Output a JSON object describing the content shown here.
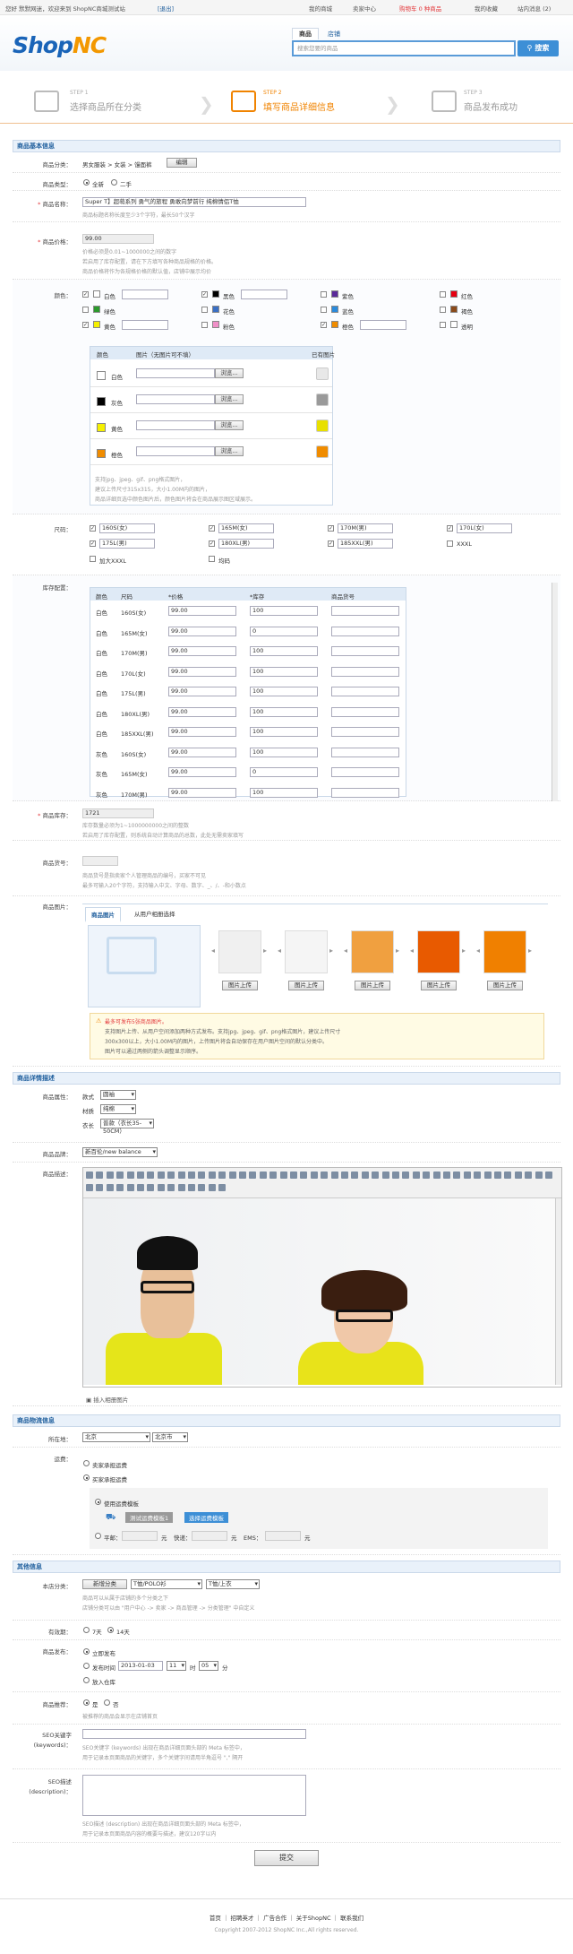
{
  "topbar": {
    "welcome": "您好 默默网迷，欢迎来到 ShopNC商城测试站",
    "logout": "[退出]",
    "my_mall": "我的商城",
    "seller_center": "卖家中心",
    "cart": "购物车 0 种商品",
    "favorites": "我的收藏",
    "messages": "站内消息 (2)"
  },
  "header": {
    "logo_shop": "Shop",
    "logo_nc": "NC",
    "tab_goods": "商品",
    "tab_store": "店铺",
    "search_placeholder": "搜索您要的商品",
    "search_btn": "搜索"
  },
  "steps": [
    {
      "n": "STEP 1",
      "label": "选择商品所在分类"
    },
    {
      "n": "STEP 2",
      "label": "填写商品详细信息"
    },
    {
      "n": "STEP 3",
      "label": "商品发布成功"
    }
  ],
  "basic": {
    "title": "商品基本信息",
    "category_label": "商品分类：",
    "category_value": "男女服装 > 女装 > 馒面裤",
    "edit_btn": "编辑",
    "type_label": "商品类型：",
    "type_new": "全新",
    "type_used": "二手",
    "name_label": "商品名称：",
    "name_value": "Super T】超萌系列 勇气的旅程 勇敢向梦前行 纯棉情侣T恤",
    "name_hint": "商品标题名称长度至少3个字符，最长50个汉字",
    "price_label": "商品价格：",
    "price_value": "99.00",
    "price_hint1": "价格必须是0.01~1000000之间的数字",
    "price_hint2": "若启用了库存配置，请在下方填写各种商品规格的价格。",
    "price_hint3": "商品价格将作为各规格价格的默认值，店铺中展示均价"
  },
  "color": {
    "label": "颜色：",
    "items": [
      {
        "name": "白色",
        "c": "#ffffff",
        "on": true
      },
      {
        "name": "黑色",
        "c": "#000000",
        "on": true
      },
      {
        "name": "紫色",
        "c": "#5a2a9a",
        "on": false
      },
      {
        "name": "红色",
        "c": "#e60012",
        "on": false
      },
      {
        "name": "绿色",
        "c": "#2c9a2c",
        "on": false
      },
      {
        "name": "花色",
        "c": "#3a6fc4",
        "on": false
      },
      {
        "name": "蓝色",
        "c": "#2a8adc",
        "on": false
      },
      {
        "name": "褐色",
        "c": "#8a4a1a",
        "on": false
      },
      {
        "name": "黄色",
        "c": "#f5f000",
        "on": true
      },
      {
        "name": "粉色",
        "c": "#f090c8",
        "on": false
      },
      {
        "name": "橙色",
        "c": "#f08c00",
        "on": true
      },
      {
        "name": "透明",
        "c": "#ffffff",
        "on": false
      }
    ],
    "table_head": {
      "color": "颜色",
      "image": "图片（无图片可不填）",
      "existing": "已有图片"
    },
    "rows": [
      {
        "name": "白色",
        "c": "#ffffff",
        "tc": "#e8e8e8"
      },
      {
        "name": "灰色",
        "c": "#000000",
        "tc": "#9a9a9a"
      },
      {
        "name": "黄色",
        "c": "#f5f000",
        "tc": "#e8e000"
      },
      {
        "name": "橙色",
        "c": "#f08c00",
        "tc": "#f08c00"
      }
    ],
    "browse": "浏览...",
    "hint1": "支持jpg、jpeg、gif、png格式图片，",
    "hint2": "建议上传尺寸315x315，大小1.00M内的图片，",
    "hint3": "商品详细页选中颜色图片后，颜色图片将会在商品展示图区域展示。"
  },
  "size": {
    "label": "尺码：",
    "items": [
      {
        "n": "160S(女)",
        "on": true,
        "i": true
      },
      {
        "n": "165M(女)",
        "on": true,
        "i": true
      },
      {
        "n": "170M(男)",
        "on": true,
        "i": true
      },
      {
        "n": "170L(女)",
        "on": true,
        "i": true
      },
      {
        "n": "175L(男)",
        "on": true,
        "i": true
      },
      {
        "n": "180XL(男)",
        "on": true,
        "i": true
      },
      {
        "n": "185XXL(男)",
        "on": true,
        "i": true
      },
      {
        "n": "XXXL",
        "on": false,
        "i": false
      },
      {
        "n": "加大XXXL",
        "on": false,
        "i": false
      },
      {
        "n": "均码",
        "on": false,
        "i": false
      }
    ]
  },
  "stock": {
    "label": "库存配置：",
    "head": {
      "color": "颜色",
      "size": "尺码",
      "price": "*价格",
      "stock": "*库存",
      "sku": "商品货号"
    },
    "rows": [
      {
        "c": "白色",
        "s": "160S(女)",
        "p": "99.00",
        "q": "100"
      },
      {
        "c": "白色",
        "s": "165M(女)",
        "p": "99.00",
        "q": "0"
      },
      {
        "c": "白色",
        "s": "170M(男)",
        "p": "99.00",
        "q": "100"
      },
      {
        "c": "白色",
        "s": "170L(女)",
        "p": "99.00",
        "q": "100"
      },
      {
        "c": "白色",
        "s": "175L(男)",
        "p": "99.00",
        "q": "100"
      },
      {
        "c": "白色",
        "s": "180XL(男)",
        "p": "99.00",
        "q": "100"
      },
      {
        "c": "白色",
        "s": "185XXL(男)",
        "p": "99.00",
        "q": "100"
      },
      {
        "c": "灰色",
        "s": "160S(女)",
        "p": "99.00",
        "q": "100"
      },
      {
        "c": "灰色",
        "s": "165M(女)",
        "p": "99.00",
        "q": "0"
      },
      {
        "c": "灰色",
        "s": "170M(男)",
        "p": "99.00",
        "q": "100"
      }
    ]
  },
  "total": {
    "label": "商品库存：",
    "value": "1721",
    "hint1": "库存数量必须为1~1000000000之间的整数",
    "hint2": "若启用了库存配置，则系统自动计算商品的总数，此处无需卖家填写"
  },
  "sku": {
    "label": "商品货号：",
    "hint1": "商品货号是指卖家个人管理商品的编号，买家不可见",
    "hint2": "最多可输入20个字符，支持输入中文、字母、数字、_、/、-和小数点"
  },
  "images": {
    "label": "商品图片：",
    "tab1": "商品图片",
    "tab2": "从用户相册选择",
    "upload": "图片上传",
    "notice_title": "最多可发布5张商品图片。",
    "notice1": "支持图片上传、从用户空间添加两种方式发布。支持jpg、jpeg、gif、png格式图片，建议上传尺寸",
    "notice2": "300x300以上，大小1.00M内的图片，上传图片将会自动保存在用户图片空间的默认分类中。",
    "notice3": "图片可以通过两侧的箭头调整显示顺序。"
  },
  "detail": {
    "title": "商品详情描述",
    "attr_label": "商品属性：",
    "attr": [
      {
        "k": "款式",
        "v": "圆袖"
      },
      {
        "k": "材质",
        "v": "纯棉"
      },
      {
        "k": "衣长",
        "v": "普款（衣长35-50CM）"
      }
    ],
    "brand_label": "商品品牌：",
    "brand_value": "新百伦/new balance",
    "desc_label": "商品描述：",
    "insert_img": "插入相册图片"
  },
  "logistics": {
    "title": "商品物流信息",
    "loc_label": "所在地：",
    "prov": "北京",
    "city": "北京市",
    "fee_label": "运费：",
    "opt1": "卖家承担运费",
    "opt2": "买家承担运费",
    "use_tpl": "使用运费模板",
    "tpl_name": "测试运费模板1",
    "choose_tpl": "选择运费模板",
    "flat": "平邮：",
    "unit": "元",
    "express": "快递：",
    "ems": "EMS："
  },
  "other": {
    "title": "其他信息",
    "cat_label": "本店分类：",
    "add_cat": "新增分类",
    "cat1": "T恤/POLO衫",
    "cat2": "T恤/上衣",
    "cat_hint1": "商品可以从属于店铺的多个分类之下",
    "cat_hint2": "店铺分类可以由 \"用户中心 -> 卖家 -> 商品管理 -> 分类管理\" 中自定义",
    "valid_label": "有效期：",
    "valid_7": "7天",
    "valid_14": "14天",
    "pub_label": "商品发布：",
    "pub_now": "立即发布",
    "pub_time": "发布时间",
    "date": "2013-01-03",
    "hour": "11",
    "minute": "05",
    "hour_u": "时",
    "min_u": "分",
    "pub_store": "放入仓库",
    "rec_label": "商品推荐：",
    "yes": "是",
    "no": "否",
    "rec_hint": "被推荐的商品会显示在店铺首页",
    "seo_kw_label": "SEO关键字",
    "seo_kw_label2": "(keywords)：",
    "seo_kw_hint1": "SEO关键字 (keywords) 出现在商品详细页面头部的 Meta 标签中，",
    "seo_kw_hint2": "用于记录本页面商品的关键字，多个关键字间请用半角逗号 \",\" 隔开",
    "seo_desc_label": "SEO描述",
    "seo_desc_label2": "(description)：",
    "seo_desc_hint1": "SEO描述 (description) 出现在商品详细页面头部的 Meta 标签中，",
    "seo_desc_hint2": "用于记录本页面商品内容的概要与描述，建议120字以内",
    "submit": "提交"
  },
  "footer": {
    "links": "首页 ｜ 招聘英才 ｜ 广告合作 ｜ 关于ShopNC ｜ 联系我们",
    "copy": "Copyright 2007-2012 ShopNC Inc.,All rights reserved."
  }
}
